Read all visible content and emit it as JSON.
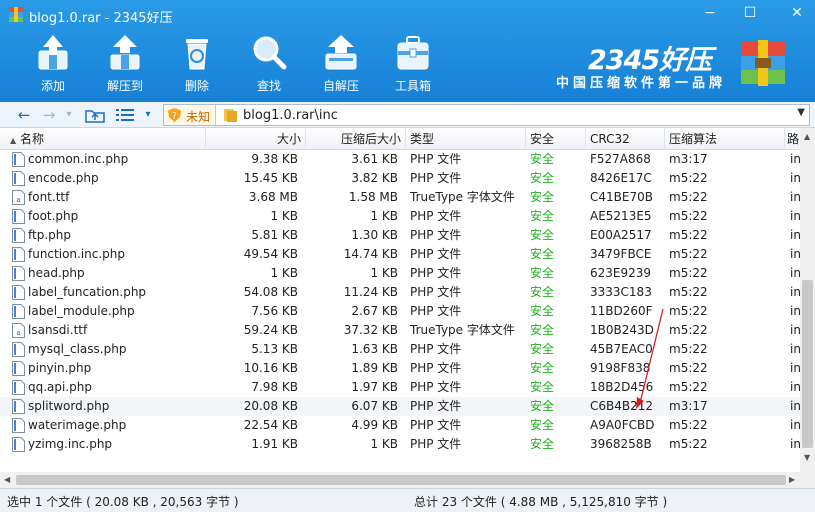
{
  "window": {
    "title": "blog1.0.rar - 2345好压",
    "min": "−",
    "max": "☐",
    "close": "✕"
  },
  "toolbar": [
    {
      "label": "添加",
      "icon": "add-icon"
    },
    {
      "label": "解压到",
      "icon": "extract-to-icon"
    },
    {
      "label": "删除",
      "icon": "delete-icon"
    },
    {
      "label": "查找",
      "icon": "search-icon"
    },
    {
      "label": "自解压",
      "icon": "self-extract-icon"
    },
    {
      "label": "工具箱",
      "icon": "toolbox-icon"
    }
  ],
  "brand": {
    "name": "2345好压",
    "slogan": "中国压缩软件第一品牌"
  },
  "addressbar": {
    "safety": "未知",
    "path": "blog1.0.rar\\inc"
  },
  "columns": [
    "名称",
    "大小",
    "压缩后大小",
    "类型",
    "安全",
    "CRC32",
    "压缩算法",
    "路"
  ],
  "files": [
    {
      "name": "common.inc.php",
      "size": "9.38 KB",
      "packed": "3.61 KB",
      "type": "PHP 文件",
      "safe": "安全",
      "crc": "F527A868",
      "method": "m3:17",
      "extra": "in",
      "icon": "php-file-icon"
    },
    {
      "name": "encode.php",
      "size": "15.45 KB",
      "packed": "3.82 KB",
      "type": "PHP 文件",
      "safe": "安全",
      "crc": "8426E17C",
      "method": "m5:22",
      "extra": "in",
      "icon": "php-file-icon"
    },
    {
      "name": "font.ttf",
      "size": "3.68 MB",
      "packed": "1.58 MB",
      "type": "TrueType 字体文件",
      "safe": "安全",
      "crc": "C41BE70B",
      "method": "m5:22",
      "extra": "in",
      "icon": "font-file-icon"
    },
    {
      "name": "foot.php",
      "size": "1 KB",
      "packed": "1 KB",
      "type": "PHP 文件",
      "safe": "安全",
      "crc": "AE5213E5",
      "method": "m5:22",
      "extra": "in",
      "icon": "php-file-icon"
    },
    {
      "name": "ftp.php",
      "size": "5.81 KB",
      "packed": "1.30 KB",
      "type": "PHP 文件",
      "safe": "安全",
      "crc": "E00A2517",
      "method": "m5:22",
      "extra": "in",
      "icon": "php-file-icon"
    },
    {
      "name": "function.inc.php",
      "size": "49.54 KB",
      "packed": "14.74 KB",
      "type": "PHP 文件",
      "safe": "安全",
      "crc": "3479FBCE",
      "method": "m5:22",
      "extra": "in",
      "icon": "php-file-icon"
    },
    {
      "name": "head.php",
      "size": "1 KB",
      "packed": "1 KB",
      "type": "PHP 文件",
      "safe": "安全",
      "crc": "623E9239",
      "method": "m5:22",
      "extra": "in",
      "icon": "php-file-icon"
    },
    {
      "name": "label_funcation.php",
      "size": "54.08 KB",
      "packed": "11.24 KB",
      "type": "PHP 文件",
      "safe": "安全",
      "crc": "3333C183",
      "method": "m5:22",
      "extra": "in",
      "icon": "php-file-icon"
    },
    {
      "name": "label_module.php",
      "size": "7.56 KB",
      "packed": "2.67 KB",
      "type": "PHP 文件",
      "safe": "安全",
      "crc": "11BD260F",
      "method": "m5:22",
      "extra": "in",
      "icon": "php-file-icon"
    },
    {
      "name": "lsansdi.ttf",
      "size": "59.24 KB",
      "packed": "37.32 KB",
      "type": "TrueType 字体文件",
      "safe": "安全",
      "crc": "1B0B243D",
      "method": "m5:22",
      "extra": "in",
      "icon": "font-file-icon"
    },
    {
      "name": "mysql_class.php",
      "size": "5.13 KB",
      "packed": "1.63 KB",
      "type": "PHP 文件",
      "safe": "安全",
      "crc": "45B7EAC0",
      "method": "m5:22",
      "extra": "in",
      "icon": "php-file-icon"
    },
    {
      "name": "pinyin.php",
      "size": "10.16 KB",
      "packed": "1.89 KB",
      "type": "PHP 文件",
      "safe": "安全",
      "crc": "9198F838",
      "method": "m5:22",
      "extra": "in",
      "icon": "php-file-icon"
    },
    {
      "name": "qq.api.php",
      "size": "7.98 KB",
      "packed": "1.97 KB",
      "type": "PHP 文件",
      "safe": "安全",
      "crc": "18B2D456",
      "method": "m5:22",
      "extra": "in",
      "icon": "php-file-icon"
    },
    {
      "name": "splitword.php",
      "size": "20.08 KB",
      "packed": "6.07 KB",
      "type": "PHP 文件",
      "safe": "安全",
      "crc": "C6B4B212",
      "method": "m3:17",
      "extra": "in",
      "icon": "php-file-icon",
      "selected": true
    },
    {
      "name": "waterimage.php",
      "size": "22.54 KB",
      "packed": "4.99 KB",
      "type": "PHP 文件",
      "safe": "安全",
      "crc": "A9A0FCBD",
      "method": "m5:22",
      "extra": "in",
      "icon": "php-file-icon"
    },
    {
      "name": "yzimg.inc.php",
      "size": "1.91 KB",
      "packed": "1 KB",
      "type": "PHP 文件",
      "safe": "安全",
      "crc": "3968258B",
      "method": "m5:22",
      "extra": "in",
      "icon": "php-file-icon"
    }
  ],
  "status": {
    "selected": "选中 1 个文件 ( 20.08 KB , 20,563 字节 )",
    "total": "总计 23 个文件 ( 4.88 MB , 5,125,810 字节 )"
  },
  "colors": {
    "accent": "#1a86da",
    "safe": "#21b321",
    "annotation_arrow": "#d62020"
  }
}
